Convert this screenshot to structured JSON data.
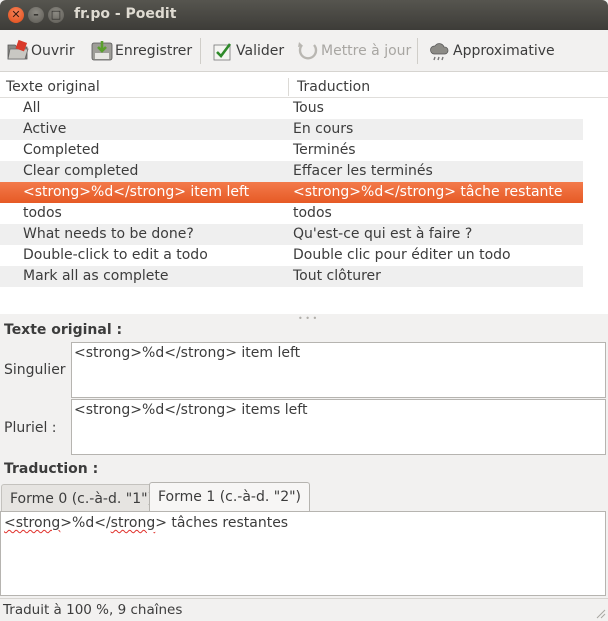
{
  "window": {
    "title": "fr.po - Poedit",
    "close_glyph": "✕",
    "minimize_glyph": "–",
    "maximize_glyph": "□"
  },
  "toolbar": {
    "open": {
      "label": "Ouvrir",
      "icon": "folder-open-icon"
    },
    "save": {
      "label": "Enregistrer",
      "icon": "save-icon"
    },
    "validate": {
      "label": "Valider",
      "icon": "checkmark-icon"
    },
    "update": {
      "label": "Mettre à jour",
      "icon": "refresh-icon",
      "disabled": true
    },
    "fuzzy": {
      "label": "Approximative",
      "icon": "fuzzy-cloud-icon"
    }
  },
  "list": {
    "columns": {
      "original": "Texte original",
      "translation": "Traduction"
    },
    "rows": [
      {
        "original": "All",
        "translation": "Tous"
      },
      {
        "original": "Active",
        "translation": "En cours"
      },
      {
        "original": "Completed",
        "translation": "Terminés"
      },
      {
        "original": "Clear completed",
        "translation": "Effacer les terminés"
      },
      {
        "original": "<strong>%d</strong> item left",
        "translation": "<strong>%d</strong> tâche restante"
      },
      {
        "original": "todos",
        "translation": "todos"
      },
      {
        "original": "What needs to be done?",
        "translation": "Qu'est-ce qui est à faire ?"
      },
      {
        "original": "Double-click to edit a todo",
        "translation": "Double clic pour éditer un todo"
      },
      {
        "original": "Mark all as complete",
        "translation": "Tout clôturer"
      }
    ],
    "selected_index": 4,
    "selected_color": "#e9622d"
  },
  "source": {
    "section_title": "Texte original :",
    "singular_label": "Singulier :",
    "singular_value": "<strong>%d</strong> item left",
    "plural_label": "Pluriel :",
    "plural_value": "<strong>%d</strong> items left"
  },
  "translation": {
    "section_title": "Traduction :",
    "tabs": [
      {
        "label": "Forme 0 (c.-à-d. \"1\")"
      },
      {
        "label": "Forme 1 (c.-à-d. \"2\")"
      }
    ],
    "active_tab": 1,
    "value_part1": "<strong",
    "value_part2": ">%d</",
    "value_part3": "strong",
    "value_part4": "> tâches restantes"
  },
  "status": {
    "text": "Traduit à 100 %, 9 chaînes"
  }
}
